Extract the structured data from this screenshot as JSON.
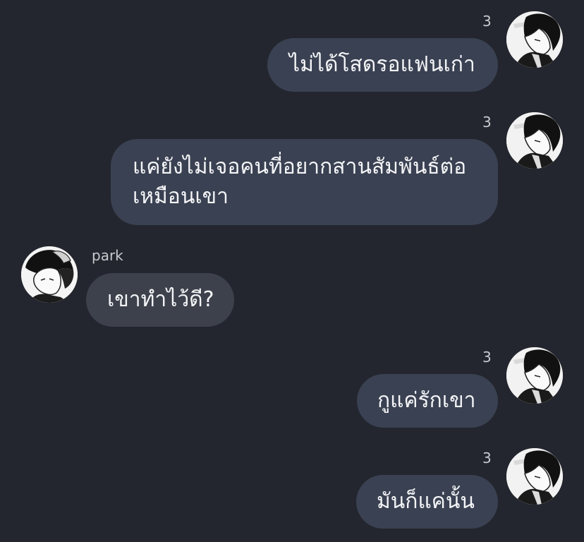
{
  "messages": [
    {
      "sender": "3",
      "text": "ไม่ได้โสดรอแฟนเก่า"
    },
    {
      "sender": "3",
      "lines": [
        "แค่ยังไม่เจอคนที่อยากสานสัมพันธ์ต่อ",
        "เหมือนเขา"
      ]
    },
    {
      "sender": "park",
      "text": "เขาทำไว้ดี?"
    },
    {
      "sender": "3",
      "text": "กูแค่รักเขา"
    },
    {
      "sender": "3",
      "text": "มันก็แค่นั้น"
    }
  ],
  "avatars": {
    "self": "manga-character-portrait-icon",
    "other": "manga-character-portrait-icon"
  },
  "colors": {
    "background": "#23262e",
    "outgoing_bubble": "#3a4152",
    "incoming_bubble": "#3d414b",
    "sender_label": "#c8cad0"
  }
}
